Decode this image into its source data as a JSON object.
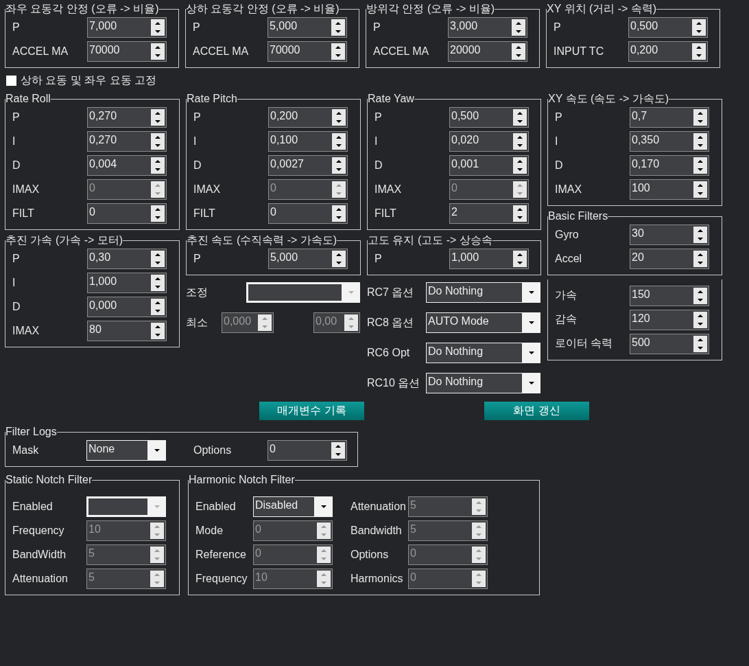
{
  "top_groups": [
    {
      "title": "좌우 요동각 안정 (오류 -> 비율)",
      "rows": [
        {
          "kind": "spin",
          "label": "P",
          "value": "7,000",
          "disabled": false
        },
        {
          "kind": "spin",
          "label": "ACCEL MA",
          "value": "70000",
          "disabled": false
        }
      ]
    },
    {
      "title": "상하 요동각 안정 (오류 -> 비율)",
      "rows": [
        {
          "kind": "spin",
          "label": "P",
          "value": "5,000",
          "disabled": false
        },
        {
          "kind": "spin",
          "label": "ACCEL MA",
          "value": "70000",
          "disabled": false
        }
      ]
    },
    {
      "title": "방위각 안정 (오류 -> 비율)",
      "rows": [
        {
          "kind": "spin",
          "label": "P",
          "value": "3,000",
          "disabled": false
        },
        {
          "kind": "spin",
          "label": "ACCEL MA",
          "value": "20000",
          "disabled": false
        }
      ]
    },
    {
      "title": "XY 위치 (거리 -> 속력)",
      "rows": [
        {
          "kind": "spin",
          "label": "P",
          "value": "0,500",
          "disabled": false
        },
        {
          "kind": "spin",
          "label": "INPUT TC",
          "value": "0,200",
          "disabled": false
        }
      ]
    }
  ],
  "lock_checkbox": {
    "label": "상하 요동 및 좌우 요동 고정",
    "checked": false
  },
  "columns": [
    {
      "items": [
        {
          "kind": "group",
          "title": "Rate Roll",
          "rows": [
            {
              "kind": "spin",
              "label": "P",
              "value": "0,270",
              "disabled": false
            },
            {
              "kind": "spin",
              "label": "I",
              "value": "0,270",
              "disabled": false
            },
            {
              "kind": "spin",
              "label": "D",
              "value": "0,004",
              "disabled": false
            },
            {
              "kind": "spin",
              "label": "IMAX",
              "value": "0",
              "disabled": true
            },
            {
              "kind": "spin",
              "label": "FILT",
              "value": "0",
              "disabled": false
            }
          ]
        },
        {
          "kind": "group",
          "title": "추진 가속 (가속 -> 모터)",
          "rows": [
            {
              "kind": "spin",
              "label": "P",
              "value": "0,30",
              "disabled": false
            },
            {
              "kind": "spin",
              "label": "I",
              "value": "1,000",
              "disabled": false
            },
            {
              "kind": "spin",
              "label": "D",
              "value": "0,000",
              "disabled": false
            },
            {
              "kind": "spin",
              "label": "IMAX",
              "value": "80",
              "disabled": false
            }
          ]
        }
      ]
    },
    {
      "items": [
        {
          "kind": "group",
          "title": "Rate Pitch",
          "rows": [
            {
              "kind": "spin",
              "label": "P",
              "value": "0,200",
              "disabled": false
            },
            {
              "kind": "spin",
              "label": "I",
              "value": "0,100",
              "disabled": false
            },
            {
              "kind": "spin",
              "label": "D",
              "value": "0,0027",
              "disabled": false
            },
            {
              "kind": "spin",
              "label": "IMAX",
              "value": "0",
              "disabled": true
            },
            {
              "kind": "spin",
              "label": "FILT",
              "value": "0",
              "disabled": false
            }
          ]
        },
        {
          "kind": "group",
          "title": "추진 속도 (수직속력 -> 가속도)",
          "rows": [
            {
              "kind": "spin",
              "label": "P",
              "value": "5,000",
              "disabled": false
            }
          ]
        },
        {
          "kind": "combo",
          "label": "조정",
          "value": "",
          "disabled": true
        },
        {
          "kind": "pair",
          "label": "최소",
          "values": [
            "0,000",
            "0,00"
          ],
          "disabled": true
        }
      ]
    },
    {
      "items": [
        {
          "kind": "group",
          "title": "Rate Yaw",
          "rows": [
            {
              "kind": "spin",
              "label": "P",
              "value": "0,500",
              "disabled": false
            },
            {
              "kind": "spin",
              "label": "I",
              "value": "0,020",
              "disabled": false
            },
            {
              "kind": "spin",
              "label": "D",
              "value": "0,001",
              "disabled": false
            },
            {
              "kind": "spin",
              "label": "IMAX",
              "value": "0",
              "disabled": true
            },
            {
              "kind": "spin",
              "label": "FILT",
              "value": "2",
              "disabled": false
            }
          ]
        },
        {
          "kind": "group",
          "title": "고도 유지 (고도 -> 상승속",
          "rows": [
            {
              "kind": "spin",
              "label": "P",
              "value": "1,000",
              "disabled": false
            }
          ]
        },
        {
          "kind": "combo",
          "label": "RC7 옵션",
          "value": "Do Nothing",
          "disabled": false
        },
        {
          "kind": "combo",
          "label": "RC8 옵션",
          "value": "AUTO Mode",
          "disabled": false
        },
        {
          "kind": "combo",
          "label": "RC6 Opt",
          "value": "Do Nothing",
          "disabled": false
        },
        {
          "kind": "combo",
          "label": "RC10 옵션",
          "value": "Do Nothing",
          "disabled": false
        }
      ]
    },
    {
      "items": [
        {
          "kind": "group",
          "title": "XY 속도 (속도 -> 가속도)",
          "rows": [
            {
              "kind": "spin",
              "label": "P",
              "value": "0,7",
              "disabled": false
            },
            {
              "kind": "spin",
              "label": "I",
              "value": "0,350",
              "disabled": false
            },
            {
              "kind": "spin",
              "label": "D",
              "value": "0,170",
              "disabled": false
            },
            {
              "kind": "spin",
              "label": "IMAX",
              "value": "100",
              "disabled": false
            }
          ]
        },
        {
          "kind": "group",
          "title": "Basic Filters",
          "rows": [
            {
              "kind": "spin",
              "label": "Gyro",
              "value": "30",
              "disabled": false
            },
            {
              "kind": "spin",
              "label": "Accel",
              "value": "20",
              "disabled": false
            }
          ]
        },
        {
          "kind": "group",
          "rows": [
            {
              "kind": "spin",
              "label": "가속",
              "value": "150",
              "disabled": false
            },
            {
              "kind": "spin",
              "label": "감속",
              "value": "120",
              "disabled": false
            },
            {
              "kind": "spin",
              "label": "로이터 속력",
              "value": "500",
              "disabled": false
            }
          ]
        }
      ]
    }
  ],
  "buttons": [
    {
      "label": "매개변수 기록"
    },
    {
      "label": "화면 갱신"
    }
  ],
  "filter_logs": {
    "title": "Filter Logs",
    "rows": [
      {
        "kind": "combo",
        "label": "Mask",
        "value": "None",
        "disabled": false
      },
      {
        "kind": "spin",
        "label": "Options",
        "value": "0",
        "disabled": false
      }
    ]
  },
  "static_notch": {
    "title": "Static Notch Filter",
    "rows": [
      {
        "kind": "combo",
        "label": "Enabled",
        "value": "",
        "disabled": true
      },
      {
        "kind": "spin",
        "label": "Frequency",
        "value": "10",
        "disabled": true
      },
      {
        "kind": "spin",
        "label": "BandWidth",
        "value": "5",
        "disabled": true
      },
      {
        "kind": "spin",
        "label": "Attenuation",
        "value": "5",
        "disabled": true
      }
    ]
  },
  "harmonic_notch": {
    "title": "Harmonic Notch Filter",
    "columns": [
      [
        {
          "kind": "combo",
          "label": "Enabled",
          "value": "Disabled",
          "disabled": false
        },
        {
          "kind": "spin",
          "label": "Mode",
          "value": "0",
          "disabled": true
        },
        {
          "kind": "spin",
          "label": "Reference",
          "value": "0",
          "disabled": true
        },
        {
          "kind": "spin",
          "label": "Frequency",
          "value": "10",
          "disabled": true
        }
      ],
      [
        {
          "kind": "spin",
          "label": "Attenuation",
          "value": "5",
          "disabled": true
        },
        {
          "kind": "spin",
          "label": "Bandwidth",
          "value": "5",
          "disabled": true
        },
        {
          "kind": "spin",
          "label": "Options",
          "value": "0",
          "disabled": true
        },
        {
          "kind": "spin",
          "label": "Harmonics",
          "value": "0",
          "disabled": true
        }
      ]
    ]
  }
}
